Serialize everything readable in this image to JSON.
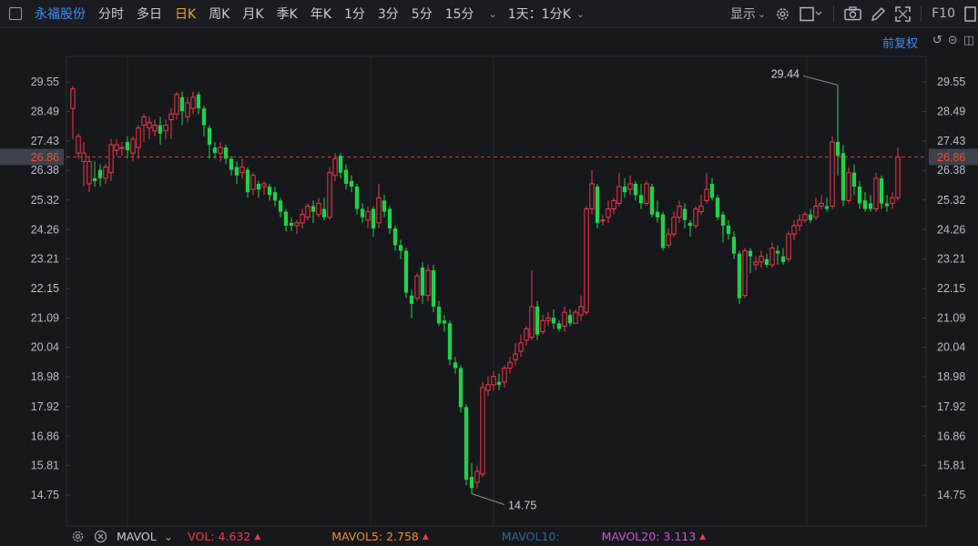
{
  "header": {
    "stock_name": "永福股份",
    "periods": [
      "分时",
      "多日",
      "日K",
      "周K",
      "月K",
      "季K",
      "年K",
      "1分",
      "3分",
      "5分",
      "15分"
    ],
    "active_period": "日K",
    "interval_label": "1天：1分K",
    "display_label": "显示",
    "f10_label": "F10"
  },
  "price_adjust_label": "前复权",
  "colors": {
    "up": "#f0384a",
    "down": "#20d24a",
    "accent": "#3b8ff0",
    "active": "#f0a030",
    "current": "#e8503a",
    "bg": "#17181c"
  },
  "bottom": {
    "indicator": "MAVOL",
    "vol_label": "VOL:",
    "vol_value": "4.632",
    "mavol5_label": "MAVOL5:",
    "mavol5_value": "2.758",
    "mavol10_label": "MAVOL10:",
    "mavol20_label": "MAVOL20:",
    "mavol20_value": "3.113"
  },
  "chart_data": {
    "type": "candlestick",
    "y_ticks": [
      "29.55",
      "28.49",
      "27.43",
      "26.38",
      "25.32",
      "24.26",
      "23.21",
      "22.15",
      "21.09",
      "20.04",
      "18.98",
      "17.92",
      "16.86",
      "15.81",
      "14.75"
    ],
    "ylim": [
      14.75,
      29.55
    ],
    "current_price": "26.86",
    "high_annotation": "29.44",
    "low_annotation": "14.75",
    "candles": [
      [
        28.6,
        29.3,
        29.4,
        27.5
      ],
      [
        27.0,
        27.6,
        27.7,
        26.8
      ],
      [
        26.7,
        27.0,
        27.4,
        25.8
      ],
      [
        25.9,
        26.7,
        26.9,
        25.6
      ],
      [
        26.1,
        26.0,
        26.7,
        25.8
      ],
      [
        26.4,
        26.1,
        26.6,
        25.8
      ],
      [
        26.1,
        26.5,
        26.6,
        25.9
      ],
      [
        26.3,
        27.3,
        27.5,
        26.0
      ],
      [
        27.1,
        27.3,
        27.5,
        26.9
      ],
      [
        27.2,
        27.2,
        27.4,
        26.9
      ],
      [
        27.4,
        27.1,
        27.6,
        26.8
      ],
      [
        27.0,
        27.5,
        27.6,
        26.7
      ],
      [
        27.2,
        27.9,
        28.0,
        26.8
      ],
      [
        28.0,
        28.3,
        28.4,
        27.4
      ],
      [
        27.9,
        28.1,
        28.3,
        27.5
      ],
      [
        27.8,
        28.0,
        28.2,
        27.6
      ],
      [
        28.0,
        27.7,
        28.3,
        27.3
      ],
      [
        27.8,
        28.0,
        28.2,
        27.5
      ],
      [
        28.2,
        28.4,
        28.6,
        27.5
      ],
      [
        28.4,
        29.1,
        29.2,
        28.2
      ],
      [
        29.0,
        28.5,
        29.2,
        28.0
      ],
      [
        28.3,
        28.8,
        29.0,
        28.1
      ],
      [
        28.6,
        29.0,
        29.2,
        28.4
      ],
      [
        29.1,
        28.6,
        29.2,
        28.4
      ],
      [
        28.6,
        28.0,
        28.7,
        27.6
      ],
      [
        27.9,
        27.3,
        28.0,
        26.8
      ],
      [
        27.2,
        27.0,
        27.4,
        26.8
      ],
      [
        27.0,
        27.2,
        27.4,
        26.7
      ],
      [
        27.2,
        26.8,
        27.3,
        26.6
      ],
      [
        26.8,
        26.4,
        26.9,
        26.2
      ],
      [
        26.5,
        26.2,
        26.7,
        25.9
      ],
      [
        26.3,
        26.5,
        26.8,
        26.1
      ],
      [
        26.4,
        25.6,
        26.5,
        25.4
      ],
      [
        25.7,
        26.2,
        26.3,
        25.5
      ],
      [
        25.9,
        25.7,
        26.0,
        25.4
      ],
      [
        25.8,
        25.9,
        26.0,
        25.5
      ],
      [
        25.8,
        25.5,
        25.9,
        25.3
      ],
      [
        25.6,
        25.3,
        25.8,
        25.1
      ],
      [
        25.3,
        24.9,
        25.4,
        24.7
      ],
      [
        24.9,
        24.4,
        25.0,
        24.2
      ],
      [
        24.5,
        24.4,
        24.7,
        24.2
      ],
      [
        24.4,
        24.5,
        24.6,
        24.1
      ],
      [
        24.5,
        24.8,
        25.0,
        24.3
      ],
      [
        24.7,
        25.1,
        25.2,
        24.6
      ],
      [
        25.1,
        24.9,
        25.3,
        24.5
      ],
      [
        24.8,
        25.2,
        25.4,
        24.7
      ],
      [
        25.0,
        24.7,
        25.4,
        24.6
      ],
      [
        24.7,
        26.3,
        26.5,
        24.6
      ],
      [
        26.2,
        26.8,
        27.0,
        26.0
      ],
      [
        26.9,
        26.3,
        27.0,
        26.1
      ],
      [
        26.4,
        25.9,
        26.6,
        25.7
      ],
      [
        26.0,
        25.8,
        26.2,
        25.6
      ],
      [
        25.8,
        25.0,
        25.9,
        24.8
      ],
      [
        25.0,
        24.7,
        25.2,
        24.5
      ],
      [
        24.6,
        24.9,
        25.1,
        24.3
      ],
      [
        25.0,
        24.3,
        25.1,
        24.0
      ],
      [
        24.5,
        25.4,
        25.9,
        24.3
      ],
      [
        25.3,
        24.9,
        25.5,
        24.7
      ],
      [
        25.0,
        24.3,
        25.1,
        24.1
      ],
      [
        24.3,
        23.7,
        24.4,
        23.5
      ],
      [
        23.7,
        23.5,
        23.9,
        23.2
      ],
      [
        23.5,
        22.0,
        23.6,
        21.8
      ],
      [
        21.9,
        21.6,
        22.1,
        21.1
      ],
      [
        21.8,
        22.6,
        22.7,
        21.7
      ],
      [
        22.9,
        21.9,
        23.1,
        21.6
      ],
      [
        21.9,
        22.8,
        23.0,
        21.7
      ],
      [
        22.8,
        21.5,
        23.0,
        21.3
      ],
      [
        21.5,
        20.9,
        21.7,
        20.8
      ],
      [
        21.0,
        20.9,
        21.2,
        20.6
      ],
      [
        20.9,
        19.6,
        21.0,
        19.4
      ],
      [
        19.5,
        19.3,
        19.7,
        19.1
      ],
      [
        19.3,
        17.9,
        19.4,
        17.7
      ],
      [
        17.9,
        15.3,
        18.0,
        15.1
      ],
      [
        15.4,
        15.0,
        15.9,
        14.8
      ],
      [
        15.2,
        15.6,
        15.8,
        15.0
      ],
      [
        15.5,
        18.6,
        18.8,
        15.4
      ],
      [
        18.5,
        18.7,
        19.0,
        18.3
      ],
      [
        18.7,
        19.0,
        19.2,
        18.5
      ],
      [
        18.8,
        18.7,
        19.1,
        18.5
      ],
      [
        18.8,
        19.3,
        19.4,
        18.6
      ],
      [
        19.3,
        19.5,
        19.7,
        19.1
      ],
      [
        19.6,
        19.8,
        20.2,
        19.4
      ],
      [
        19.9,
        20.2,
        20.5,
        19.7
      ],
      [
        20.3,
        20.7,
        20.8,
        20.1
      ],
      [
        20.4,
        21.5,
        22.8,
        20.3
      ],
      [
        21.5,
        20.5,
        21.7,
        20.3
      ],
      [
        20.6,
        21.0,
        21.2,
        20.5
      ],
      [
        21.0,
        21.1,
        21.3,
        20.8
      ],
      [
        21.1,
        20.9,
        21.4,
        20.7
      ],
      [
        20.9,
        20.7,
        21.0,
        20.6
      ],
      [
        20.8,
        21.3,
        21.5,
        20.6
      ],
      [
        21.2,
        20.9,
        21.4,
        20.8
      ],
      [
        20.9,
        21.3,
        21.4,
        20.9
      ],
      [
        21.2,
        21.5,
        21.9,
        21.0
      ],
      [
        21.3,
        25.0,
        25.1,
        21.2
      ],
      [
        25.0,
        25.9,
        26.4,
        24.8
      ],
      [
        25.8,
        24.5,
        25.9,
        24.3
      ],
      [
        24.6,
        24.6,
        24.8,
        24.4
      ],
      [
        24.7,
        25.0,
        25.3,
        24.5
      ],
      [
        25.0,
        25.3,
        25.4,
        24.8
      ],
      [
        25.2,
        25.8,
        26.3,
        25.1
      ],
      [
        25.8,
        25.6,
        26.1,
        25.4
      ],
      [
        25.7,
        25.9,
        26.2,
        25.5
      ],
      [
        25.9,
        25.5,
        26.0,
        25.3
      ],
      [
        25.5,
        25.2,
        25.9,
        25.0
      ],
      [
        25.2,
        25.9,
        26.0,
        25.1
      ],
      [
        25.8,
        24.8,
        25.9,
        24.7
      ],
      [
        24.9,
        24.7,
        25.3,
        24.5
      ],
      [
        24.8,
        23.6,
        24.9,
        23.5
      ],
      [
        23.7,
        24.1,
        24.3,
        23.6
      ],
      [
        24.1,
        24.7,
        24.9,
        24.0
      ],
      [
        24.7,
        25.1,
        25.3,
        24.5
      ],
      [
        25.0,
        24.6,
        25.2,
        24.3
      ],
      [
        24.5,
        24.4,
        24.6,
        24.0
      ],
      [
        24.4,
        25.0,
        25.1,
        24.3
      ],
      [
        24.9,
        25.1,
        25.5,
        24.8
      ],
      [
        25.3,
        25.7,
        26.3,
        25.2
      ],
      [
        25.9,
        25.4,
        26.1,
        25.3
      ],
      [
        25.4,
        24.7,
        25.5,
        24.6
      ],
      [
        24.8,
        24.4,
        24.9,
        23.8
      ],
      [
        24.4,
        24.1,
        24.6,
        23.9
      ],
      [
        24.0,
        23.4,
        24.2,
        23.2
      ],
      [
        23.4,
        21.8,
        23.5,
        21.6
      ],
      [
        21.9,
        23.5,
        23.6,
        21.8
      ],
      [
        23.5,
        23.3,
        23.6,
        22.7
      ],
      [
        23.0,
        23.1,
        23.3,
        22.8
      ],
      [
        23.1,
        23.3,
        23.5,
        22.9
      ],
      [
        23.2,
        23.0,
        23.4,
        22.9
      ],
      [
        23.0,
        23.6,
        23.8,
        22.9
      ],
      [
        23.5,
        23.4,
        23.7,
        23.0
      ],
      [
        23.3,
        23.1,
        23.6,
        23.0
      ],
      [
        23.2,
        24.1,
        24.2,
        23.1
      ],
      [
        24.1,
        24.4,
        24.6,
        23.9
      ],
      [
        24.4,
        24.6,
        24.8,
        24.2
      ],
      [
        24.6,
        24.8,
        24.9,
        24.5
      ],
      [
        24.8,
        24.6,
        25.0,
        24.5
      ],
      [
        24.7,
        25.1,
        25.4,
        24.6
      ],
      [
        25.1,
        25.2,
        25.5,
        25.0
      ],
      [
        25.1,
        25.0,
        25.4,
        24.9
      ],
      [
        25.1,
        27.4,
        27.6,
        25.0
      ],
      [
        27.4,
        26.9,
        29.44,
        26.2
      ],
      [
        27.0,
        25.3,
        27.3,
        25.1
      ],
      [
        25.3,
        26.3,
        26.5,
        25.2
      ],
      [
        26.3,
        25.8,
        26.6,
        25.5
      ],
      [
        25.8,
        25.2,
        26.0,
        25.0
      ],
      [
        25.3,
        25.0,
        25.6,
        24.9
      ],
      [
        25.2,
        25.0,
        25.5,
        24.9
      ],
      [
        25.0,
        26.1,
        26.3,
        24.9
      ],
      [
        26.1,
        25.2,
        26.2,
        25.0
      ],
      [
        25.2,
        25.1,
        25.5,
        24.9
      ],
      [
        25.2,
        25.4,
        25.6,
        25.0
      ],
      [
        25.4,
        26.86,
        27.2,
        25.3
      ]
    ]
  }
}
